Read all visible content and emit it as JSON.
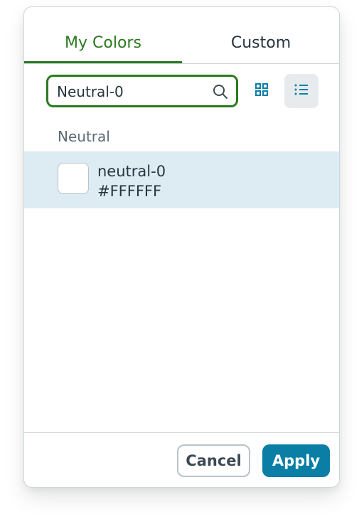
{
  "tabs": {
    "my_colors": "My Colors",
    "custom": "Custom",
    "active": "My Colors"
  },
  "search": {
    "value": "Neutral-0",
    "icon": "search-icon"
  },
  "view_toggle": {
    "grid_icon": "grid-view-icon",
    "list_icon": "list-view-icon",
    "active": "list"
  },
  "group": {
    "label": "Neutral",
    "items": [
      {
        "name": "neutral-0",
        "hex": "#FFFFFF",
        "selected": true
      }
    ]
  },
  "footer": {
    "cancel_label": "Cancel",
    "apply_label": "Apply"
  },
  "colors": {
    "accent_green": "#2b7a1f",
    "primary_blue": "#0a7ea5",
    "selected_row_bg": "#dcecf2"
  }
}
